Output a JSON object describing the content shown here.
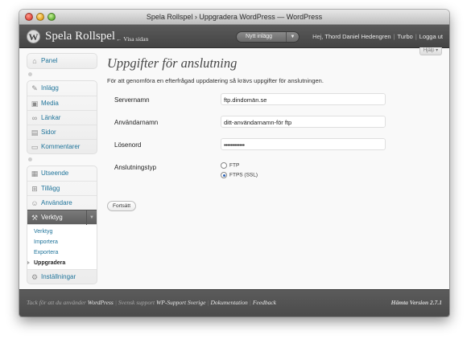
{
  "window": {
    "title": "Spela Rollspel › Uppgradera WordPress — WordPress"
  },
  "header": {
    "site_name": "Spela Rollspel",
    "visit_site": "← Visa sidan",
    "new_post_button": "Nytt inlägg",
    "greeting": "Hej, ",
    "user_name": "Thord Daniel Hedengren",
    "turbo": "Turbo",
    "logout": "Logga ut"
  },
  "help_button": "Hjälp ▾",
  "sidebar": {
    "dashboard": "Panel",
    "group2": [
      "Inlägg",
      "Media",
      "Länkar",
      "Sidor",
      "Kommentarer"
    ],
    "appearance": "Utseende",
    "plugins": "Tillägg",
    "users": "Användare",
    "tools": "Verktyg",
    "tools_sub": [
      "Verktyg",
      "Importera",
      "Exportera",
      "Uppgradera"
    ],
    "settings": "Inställningar"
  },
  "main": {
    "title": "Uppgifter för anslutning",
    "intro": "För att genomföra en efterfrågad uppdatering så krävs uppgifter för anslutningen.",
    "server_label": "Servernamn",
    "server_value": "ftp.dindomän.se",
    "username_label": "Användarnamn",
    "username_value": "ditt-användarnamn-för ftp",
    "password_label": "Lösenord",
    "password_value": "••••••••••••",
    "conn_type_label": "Anslutningstyp",
    "ftp_option": "FTP",
    "ftps_option": "FTPS (SSL)",
    "submit": "Fortsätt"
  },
  "footer": {
    "thanks": "Tack för att du använder ",
    "wordpress": "WordPress",
    "support_prefix": "Svensk support ",
    "support_name": "WP-Support Sverige",
    "docs": "Dokumentation",
    "feedback": "Feedback",
    "version": "Hämta Version 2.7.1"
  }
}
